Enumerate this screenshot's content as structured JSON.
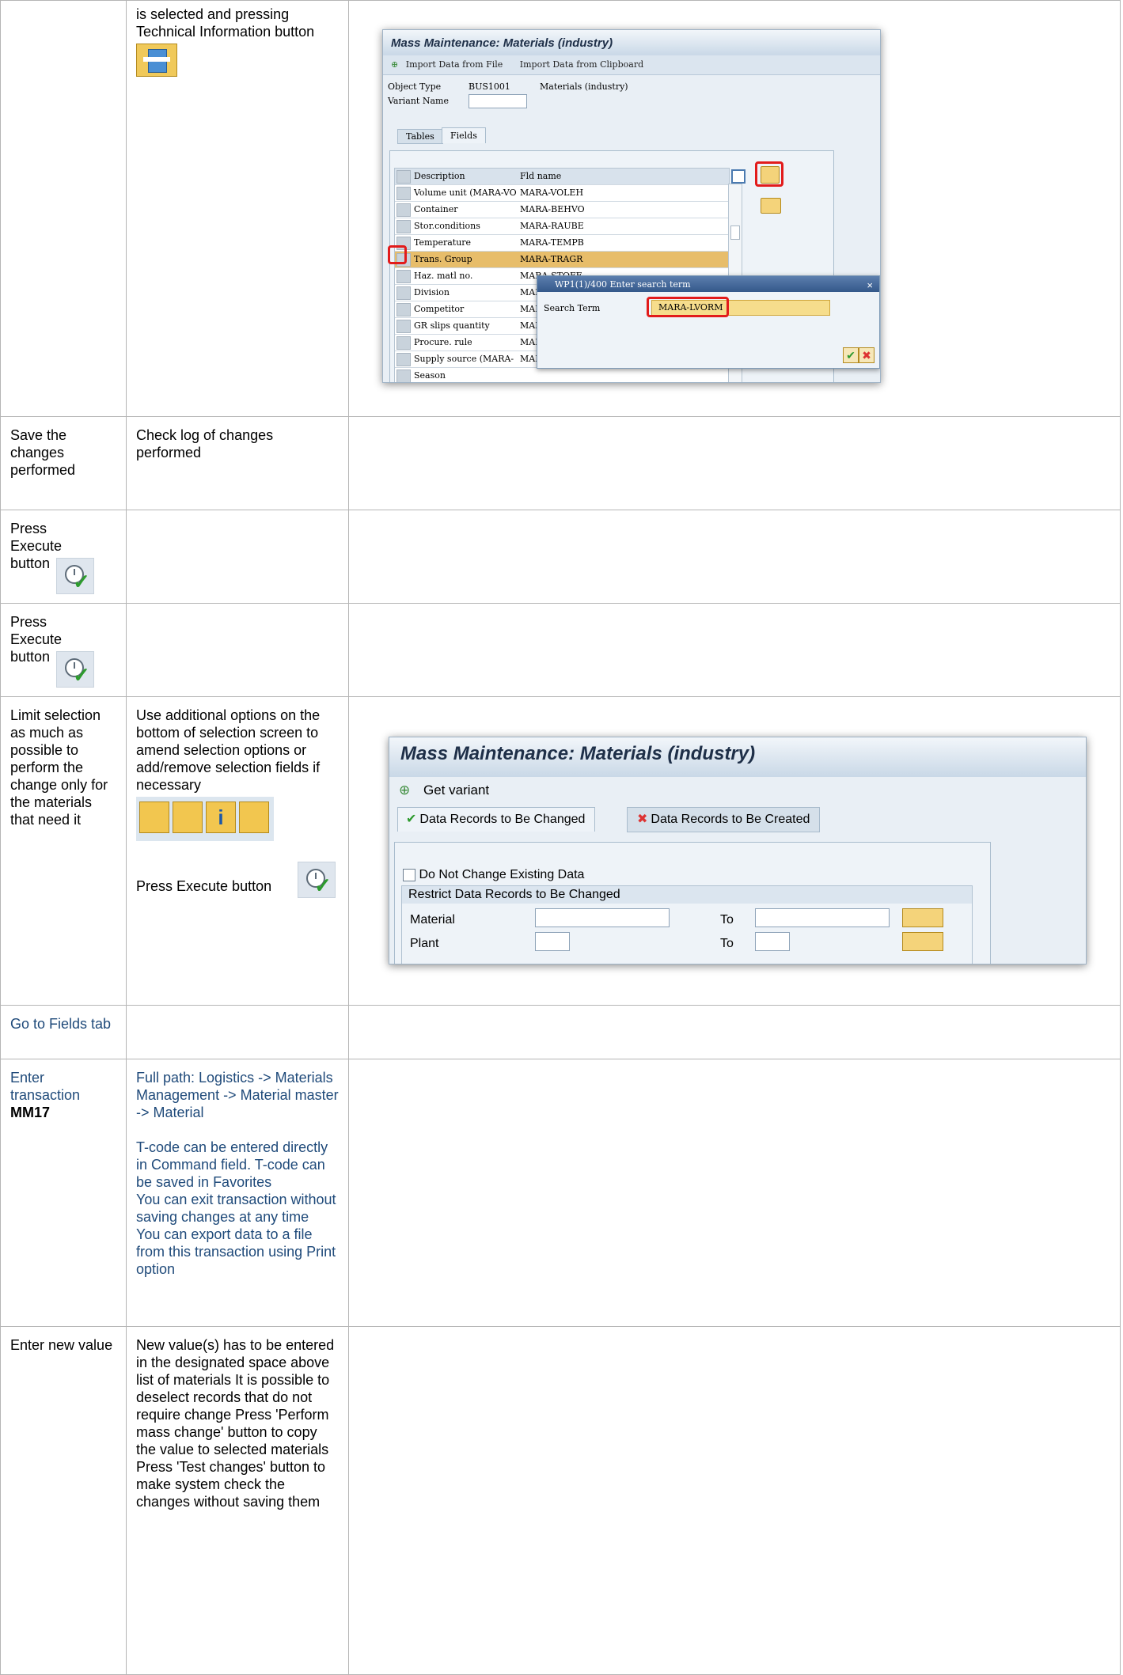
{
  "rows": [
    {
      "col1": "",
      "col2": "is selected and pressing Technical Information button",
      "screenshot": {
        "title": "Mass Maintenance: Materials (industry)",
        "toolbar": [
          "Import Data from File",
          "Import Data from Clipboard"
        ],
        "object_type_label": "Object Type",
        "object_type_value": "BUS1001",
        "object_type_desc": "Materials (industry)",
        "variant_label": "Variant Name",
        "tabs": [
          "Tables",
          "Fields"
        ],
        "grid_headers": [
          "Description",
          "Fld name"
        ],
        "grid_rows": [
          {
            "desc": "Volume unit (MARA-VO",
            "fld": "MARA-VOLEH"
          },
          {
            "desc": "Container",
            "fld": "MARA-BEHVO"
          },
          {
            "desc": "Stor.conditions",
            "fld": "MARA-RAUBE"
          },
          {
            "desc": "Temperature",
            "fld": "MARA-TEMPB"
          },
          {
            "desc": "Trans. Group",
            "fld": "MARA-TRAGR"
          },
          {
            "desc": "Haz. matl no.",
            "fld": "MARA-STOFF"
          },
          {
            "desc": "Division",
            "fld": "MARA"
          },
          {
            "desc": "Competitor",
            "fld": "MARA"
          },
          {
            "desc": "GR slips quantity",
            "fld": "MARA"
          },
          {
            "desc": "Procure. rule",
            "fld": "MARA"
          },
          {
            "desc": "Supply source (MARA-",
            "fld": "MARA"
          },
          {
            "desc": "Season",
            "fld": ""
          }
        ],
        "dialog_title": "WP1(1)/400 Enter search term",
        "dialog_label": "Search Term",
        "dialog_value": "MARA-LVORM"
      }
    },
    {
      "col1": "Save the changes performed",
      "col2": "Check log of changes performed"
    },
    {
      "col1": "Press Execute button",
      "col2": ""
    },
    {
      "col1": "Press Execute button",
      "col2": ""
    },
    {
      "col1": "Limit selection as much as possible to perform the change only for the materials that need it",
      "col2": "Use additional options on the bottom of selection screen to amend selection options or add/remove selection fields if necessary",
      "col2b": "Press Execute button",
      "screenshot": {
        "title": "Mass Maintenance: Materials (industry)",
        "get_variant": "Get variant",
        "tab_changed": "Data Records to Be Changed",
        "tab_created": "Data Records to Be Created",
        "checkbox_label": "Do Not Change Existing Data",
        "group_title": "Restrict Data Records to Be Changed",
        "field1": "Material",
        "field2": "Plant",
        "to_label": "To"
      }
    },
    {
      "col1": "Go to Fields tab",
      "col2": ""
    },
    {
      "col1_pre": "Enter transaction ",
      "col1_bold": "MM17",
      "col2_p1": "Full path: Logistics -> Materials Management -> Material master -> Material",
      "col2_p2": "T-code can be entered directly in Command field. T-code can be saved in Favorites",
      "col2_p3": "You can exit transaction without saving changes at any time",
      "col2_p4": "You can export data to a file from this transaction using Print option"
    },
    {
      "col1": "Enter new value",
      "col2": "New value(s) has to be entered in the designated space above list of materials It is possible to deselect records that do not require change Press 'Perform mass change' button to copy the value to selected materials Press 'Test changes' button to make system check the changes without saving them"
    }
  ]
}
